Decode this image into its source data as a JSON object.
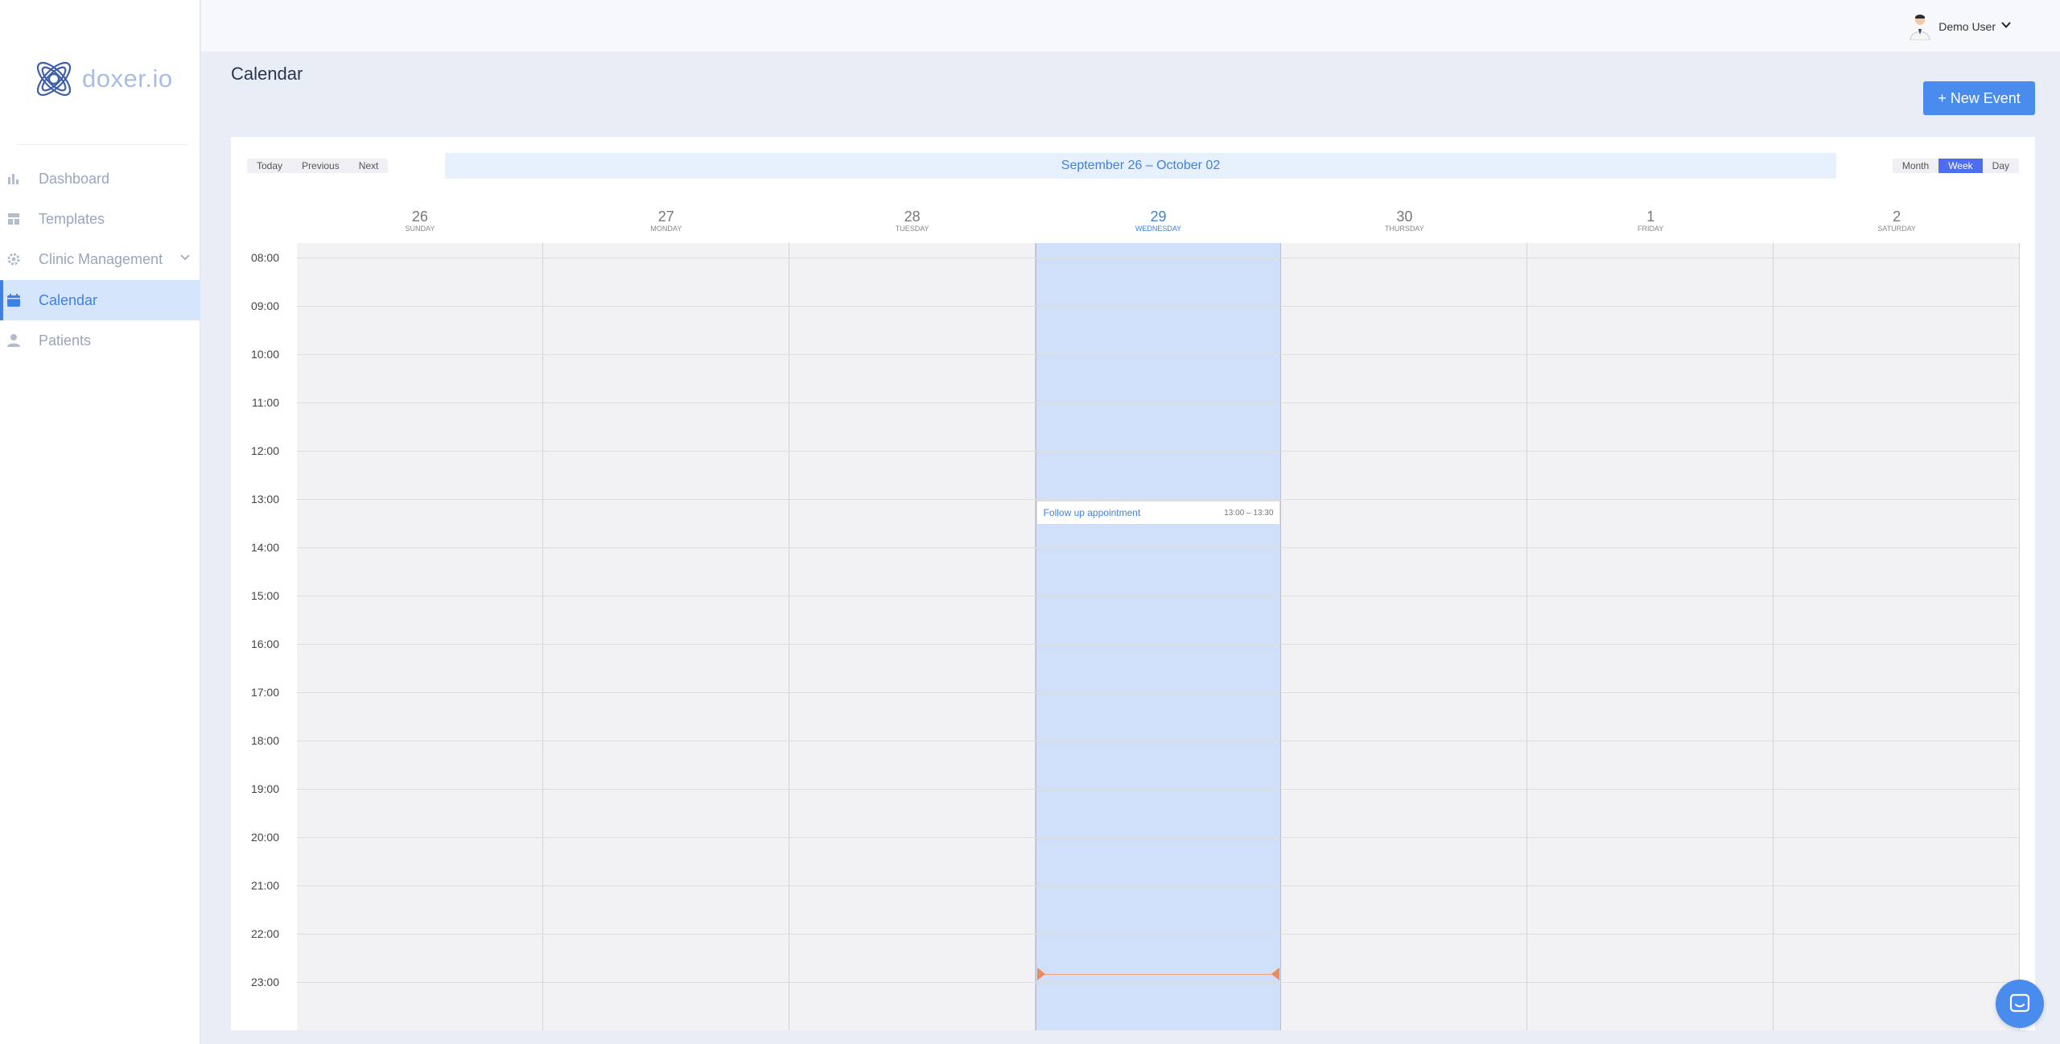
{
  "app": {
    "brand": "doxer.io"
  },
  "sidebar": {
    "items": [
      {
        "label": "Dashboard",
        "icon": "bar-chart-icon"
      },
      {
        "label": "Templates",
        "icon": "templates-icon"
      },
      {
        "label": "Clinic Management",
        "icon": "gear-icon"
      },
      {
        "label": "Calendar",
        "icon": "calendar-icon",
        "active": true
      },
      {
        "label": "Patients",
        "icon": "person-icon"
      }
    ]
  },
  "header": {
    "user_name": "Demo User"
  },
  "page": {
    "title": "Calendar",
    "new_event_label": "+ New Event"
  },
  "toolbar": {
    "today": "Today",
    "previous": "Previous",
    "next": "Next",
    "range": "September 26 – October 02",
    "views": [
      "Month",
      "Week",
      "Day"
    ],
    "active_view": "Week"
  },
  "days": [
    {
      "num": "26",
      "name": "SUNDAY"
    },
    {
      "num": "27",
      "name": "MONDAY"
    },
    {
      "num": "28",
      "name": "TUESDAY"
    },
    {
      "num": "29",
      "name": "WEDNESDAY",
      "today": true
    },
    {
      "num": "30",
      "name": "THURSDAY"
    },
    {
      "num": "1",
      "name": "FRIDAY"
    },
    {
      "num": "2",
      "name": "SATURDAY"
    }
  ],
  "hours": [
    "08:00",
    "09:00",
    "10:00",
    "11:00",
    "12:00",
    "13:00",
    "14:00",
    "15:00",
    "16:00",
    "17:00",
    "18:00",
    "19:00",
    "20:00",
    "21:00",
    "22:00",
    "23:00"
  ],
  "event": {
    "title": "Follow up appointment",
    "time": "13:00 – 13:30"
  },
  "colors": {
    "accent": "#3f80e6",
    "today_column": "#d1e0fa",
    "now_indicator": "#f08a5d",
    "primary_button": "#4a8cee"
  }
}
